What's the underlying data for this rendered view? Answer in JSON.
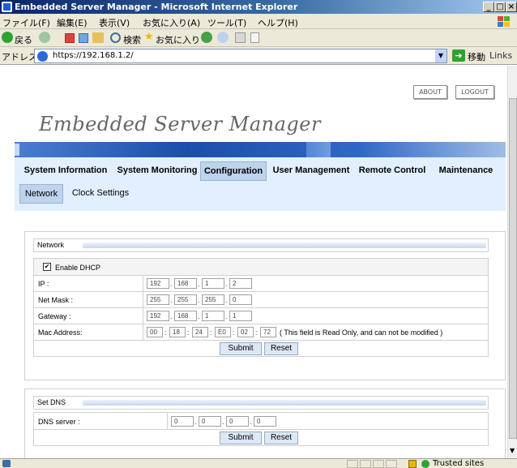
{
  "window": {
    "title": "Embedded Server Manager - Microsoft Internet Explorer",
    "controls": [
      "_",
      "□",
      "×"
    ]
  },
  "menubar": [
    "ファイル(F)",
    "編集(E)",
    "表示(V)",
    "お気に入り(A)",
    "ツール(T)",
    "ヘルプ(H)"
  ],
  "toolbar": {
    "back": "戻る",
    "search": "検索",
    "favorites": "お気に入り"
  },
  "addressbar": {
    "label": "アドレス(D)",
    "url": "https://192.168.1.2/",
    "go": "移動",
    "links": "Links"
  },
  "header": {
    "about": "ABOUT",
    "logout": "LOGOUT",
    "brand": "Embedded Server Manager"
  },
  "nav": {
    "tabs": [
      "System Information",
      "System Monitoring",
      "Configuration",
      "User Management",
      "Remote Control",
      "Maintenance"
    ],
    "active": "Configuration",
    "subtabs": [
      "Network",
      "Clock Settings"
    ],
    "active_sub": "Network"
  },
  "network": {
    "title": "Network",
    "dhcp_label": "Enable DHCP",
    "dhcp_checked": "✔",
    "ip_label": "IP :",
    "ip": [
      "192",
      "168",
      "1",
      "2"
    ],
    "mask_label": "Net Mask :",
    "mask": [
      "255",
      "255",
      "255",
      "0"
    ],
    "gateway_label": "Gateway :",
    "gateway": [
      "192",
      "168",
      "1",
      "1"
    ],
    "mac_label": "Mac Address:",
    "mac": [
      "00",
      "18",
      "24",
      "E0",
      "02",
      "72"
    ],
    "mac_note": "( This field is Read Only, and can not be modified )",
    "submit": "Submit",
    "reset": "Reset",
    "dot": ".",
    "colon": ":"
  },
  "dns": {
    "title": "Set DNS",
    "server_label": "DNS server :",
    "server": [
      "0",
      "0",
      "0",
      "0"
    ],
    "submit": "Submit",
    "reset": "Reset"
  },
  "statusbar": {
    "zone": "Trusted sites"
  }
}
